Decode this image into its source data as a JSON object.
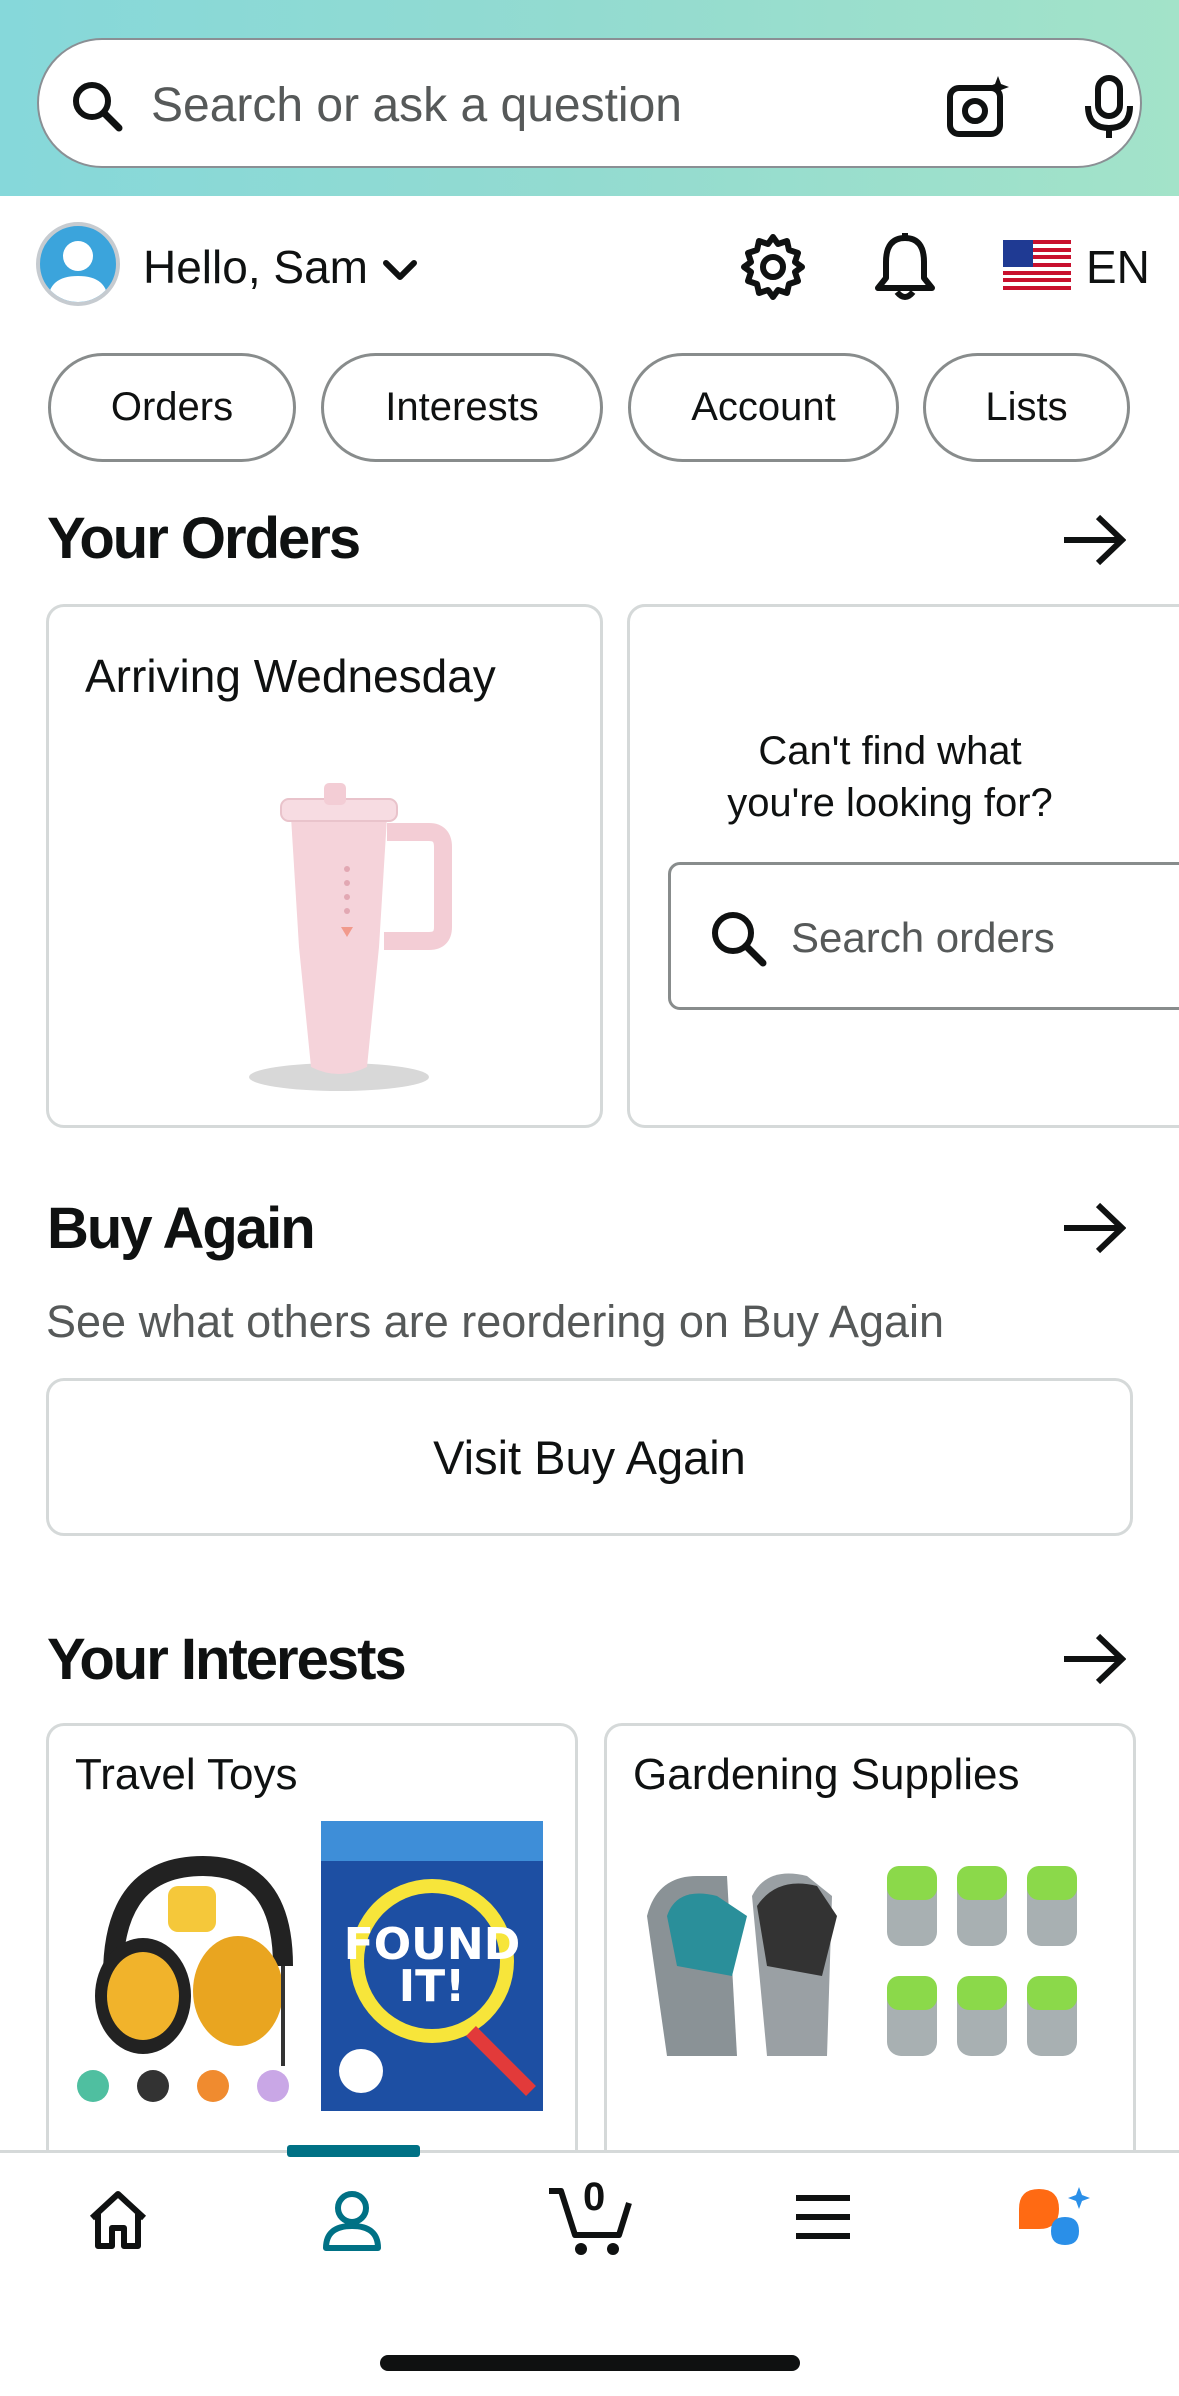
{
  "search": {
    "placeholder": "Search or ask a question"
  },
  "header": {
    "greeting": "Hello, Sam",
    "language": "EN"
  },
  "chips": [
    {
      "label": "Orders"
    },
    {
      "label": "Interests"
    },
    {
      "label": "Account"
    },
    {
      "label": "Lists"
    }
  ],
  "orders": {
    "title": "Your Orders",
    "card1": {
      "title": "Arriving Wednesday"
    },
    "card2": {
      "prompt": "Can't find what you're looking for?",
      "search_placeholder": "Search orders"
    }
  },
  "buy_again": {
    "title": "Buy Again",
    "subtitle": "See what others are reordering on Buy Again",
    "button": "Visit Buy Again"
  },
  "interests": {
    "title": "Your Interests",
    "cards": [
      {
        "title": "Travel Toys"
      },
      {
        "title": "Gardening Supplies"
      }
    ]
  },
  "bottom_nav": {
    "cart_count": "0"
  },
  "colors": {
    "accent": "#007185",
    "banner_start": "#86d8da",
    "banner_end": "#a3e3c9",
    "ai_orange": "#ff6a13",
    "ai_blue": "#2a8fe8"
  }
}
